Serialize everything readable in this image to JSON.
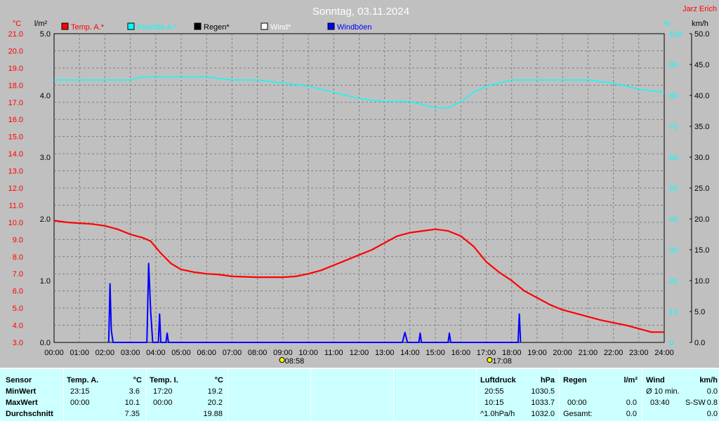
{
  "title": "Sonntag, 03.11.2024",
  "station": "Jarz Erich",
  "colors": {
    "background": "#c0c0c0",
    "plot": "#c0c0c0",
    "grid": "#808080",
    "temp": "#ff0000",
    "humidity": "#00ffff",
    "rain": "#000000",
    "wind": "#ffffff",
    "gust": "#0000ff",
    "table_bg": "#ccffff"
  },
  "axes": {
    "left_temp_unit": "°C",
    "left_rain_unit": "l/m²",
    "right_hum_unit": "%",
    "right_wind_unit": "km/h",
    "temp_ticks": [
      "21.0",
      "20.0",
      "19.0",
      "18.0",
      "17.0",
      "16.0",
      "15.0",
      "14.0",
      "13.0",
      "12.0",
      "11.0",
      "10.0",
      "9.0",
      "8.0",
      "7.0",
      "6.0",
      "5.0",
      "4.0",
      "3.0"
    ],
    "rain_ticks": [
      "5.0",
      "4.0",
      "3.0",
      "2.0",
      "1.0",
      "0.0"
    ],
    "hum_ticks": [
      "100",
      "90",
      "80",
      "70",
      "60",
      "50",
      "40",
      "30",
      "20",
      "10",
      "0"
    ],
    "wind_ticks": [
      "50.0",
      "45.0",
      "40.0",
      "35.0",
      "30.0",
      "25.0",
      "20.0",
      "15.0",
      "10.0",
      "5.0",
      "0.0"
    ],
    "x_ticks": [
      "00:00",
      "01:00",
      "02:00",
      "03:00",
      "04:00",
      "05:00",
      "06:00",
      "07:00",
      "08:00",
      "09:00",
      "10:00",
      "11:00",
      "12:00",
      "13:00",
      "14:00",
      "15:00",
      "16:00",
      "17:00",
      "18:00",
      "19:00",
      "20:00",
      "21:00",
      "22:00",
      "23:00",
      "24:00"
    ],
    "sunrise": "08:58",
    "sunset": "17:08"
  },
  "legend": [
    "Temp. A.*",
    "Feuchte A.*",
    "Regen*",
    "Wind*",
    "Windböen"
  ],
  "chart_data": {
    "type": "line",
    "title": "Sonntag, 03.11.2024",
    "x_unit": "hour",
    "xlim": [
      0,
      24
    ],
    "temp_ylim": [
      3.0,
      21.0
    ],
    "rain_ylim": [
      0.0,
      5.0
    ],
    "hum_ylim": [
      0,
      100
    ],
    "wind_ylim": [
      0.0,
      50.0
    ],
    "grid": true,
    "legend_position": "top-left",
    "series": [
      {
        "name": "Temp. A.*",
        "axis": "temp",
        "x": [
          0,
          0.5,
          1,
          1.5,
          2,
          2.5,
          3,
          3.5,
          3.8,
          4.2,
          4.6,
          5,
          5.5,
          6,
          6.5,
          7,
          8,
          9,
          9.5,
          10,
          10.5,
          11,
          11.5,
          12,
          12.5,
          13,
          13.5,
          14,
          14.5,
          15,
          15.5,
          16,
          16.5,
          17,
          17.5,
          18,
          18.5,
          19,
          19.5,
          20,
          20.5,
          21,
          21.5,
          22,
          22.5,
          23,
          23.5,
          24
        ],
        "y": [
          10.1,
          10.0,
          9.95,
          9.9,
          9.8,
          9.6,
          9.3,
          9.1,
          8.9,
          8.2,
          7.6,
          7.25,
          7.1,
          7.0,
          6.95,
          6.85,
          6.8,
          6.8,
          6.85,
          7.0,
          7.2,
          7.5,
          7.8,
          8.1,
          8.4,
          8.8,
          9.2,
          9.4,
          9.5,
          9.6,
          9.5,
          9.2,
          8.6,
          7.7,
          7.1,
          6.6,
          6.0,
          5.6,
          5.2,
          4.9,
          4.7,
          4.5,
          4.3,
          4.15,
          4.0,
          3.8,
          3.6,
          3.6
        ]
      },
      {
        "name": "Feuchte A.*",
        "axis": "hum",
        "x": [
          0,
          1,
          2,
          3,
          3.5,
          4,
          5,
          6,
          7,
          8,
          9,
          10,
          11,
          12,
          13,
          14,
          14.5,
          15,
          15.5,
          16,
          16.5,
          17,
          17.5,
          18,
          19,
          20,
          21,
          22,
          23,
          24
        ],
        "y": [
          85,
          85,
          85,
          85,
          86,
          86,
          86,
          86,
          85,
          85,
          84,
          83,
          81,
          79,
          78,
          78,
          77,
          76,
          76,
          78,
          81,
          83,
          84,
          85,
          85,
          85,
          85,
          84,
          82,
          81
        ]
      },
      {
        "name": "Windböen",
        "axis": "wind",
        "x": [
          2.15,
          2.2,
          2.25,
          2.32,
          3.65,
          3.72,
          3.8,
          3.88,
          4.1,
          4.15,
          4.2,
          4.4,
          4.45,
          4.5,
          13.7,
          13.8,
          13.9,
          14.35,
          14.4,
          14.45,
          15.5,
          15.55,
          15.6,
          18.25,
          18.3,
          18.35
        ],
        "y": [
          0.0,
          9.5,
          2.0,
          0.0,
          0.0,
          12.8,
          5.0,
          0.0,
          0.0,
          4.6,
          0.0,
          0.0,
          1.5,
          0.0,
          0.0,
          1.6,
          0.0,
          0.0,
          1.5,
          0.0,
          0.0,
          1.5,
          0.0,
          0.0,
          4.6,
          0.0
        ]
      },
      {
        "name": "Regen*",
        "axis": "rain",
        "x": [
          0,
          24
        ],
        "y": [
          0.0,
          0.0
        ]
      },
      {
        "name": "Wind*",
        "axis": "wind",
        "x": [
          0,
          24
        ],
        "y": [
          0.0,
          0.0
        ]
      }
    ]
  },
  "table": {
    "row_labels": [
      "Sensor",
      "MinWert",
      "MaxWert",
      "Durchschnitt"
    ],
    "temp_a": {
      "label": "Temp. A.",
      "unit": "°C",
      "min_time": "23:15",
      "min": "3.6",
      "max_time": "00:00",
      "max": "10.1",
      "avg": "7.35"
    },
    "temp_i": {
      "label": "Temp. I.",
      "unit": "°C",
      "min_time": "17:20",
      "min": "19.2",
      "max_time": "00:00",
      "max": "20.2",
      "avg": "19.88"
    },
    "pressure": {
      "label": "Luftdruck",
      "unit": "hPa",
      "min_time": "20:55",
      "min": "1030.5",
      "max_time": "10:15",
      "max": "1033.7",
      "trend_label": "^1.0hPa/h",
      "avg": "1032.0"
    },
    "rain": {
      "label": "Regen",
      "unit": "l/m²",
      "max_time": "00:00",
      "max": "0.0",
      "total_label": "Gesamt:",
      "total": "0.0"
    },
    "wind": {
      "label": "Wind",
      "unit": "km/h",
      "avg_label": "Ø 10 min.",
      "avg": "0.0",
      "max_time": "03:40",
      "max_dir": "S-SW",
      "max": "0.8",
      "extra": "0.0"
    }
  }
}
